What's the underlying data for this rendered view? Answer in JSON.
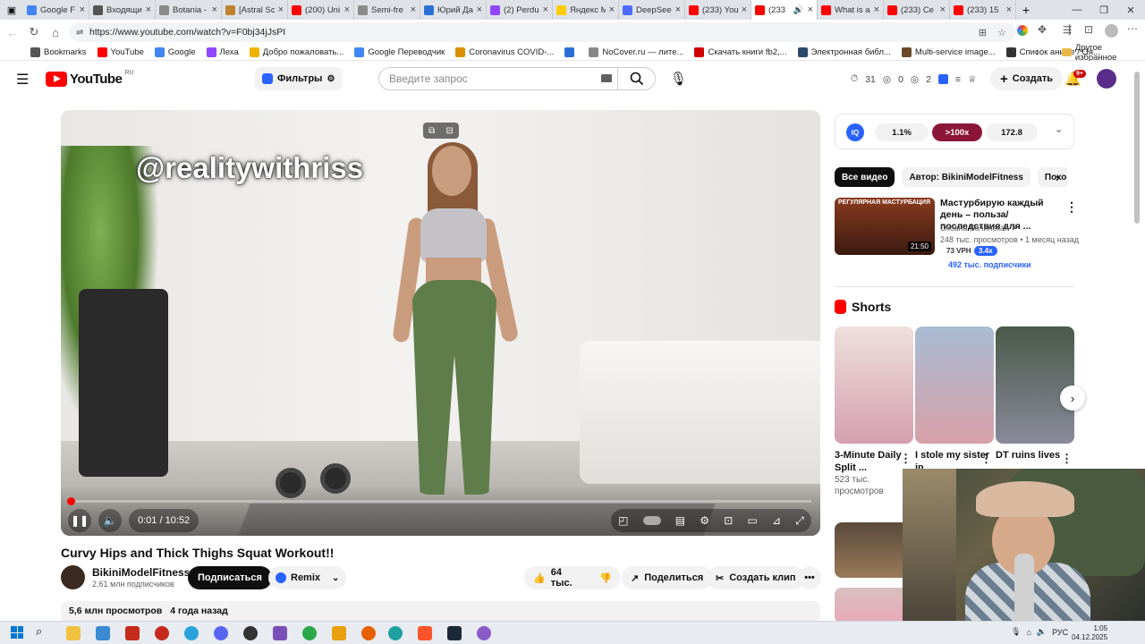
{
  "browser": {
    "tabs": [
      {
        "title": "Google F",
        "color": "#4285f4"
      },
      {
        "title": "Входящи",
        "color": "#555555"
      },
      {
        "title": "Botania -",
        "color": "#8a8a8a"
      },
      {
        "title": "[Astral Sc",
        "color": "#c0842c"
      },
      {
        "title": "(200) Uni",
        "color": "#ff0000"
      },
      {
        "title": "Semi-fre",
        "color": "#8a8a8a"
      },
      {
        "title": "Юрий Да",
        "color": "#2a6fd6"
      },
      {
        "title": "(2) Perdu",
        "color": "#9146ff"
      },
      {
        "title": "Яндекс М",
        "color": "#ffcc00"
      },
      {
        "title": "DeepSee",
        "color": "#4d6bfe"
      },
      {
        "title": "(233) You",
        "color": "#ff0000"
      },
      {
        "title": "(233",
        "color": "#ff0000",
        "active": true,
        "audio": "🔊"
      },
      {
        "title": "What is a",
        "color": "#ff0000"
      },
      {
        "title": "(233) Се",
        "color": "#ff0000"
      },
      {
        "title": "(233) 15",
        "color": "#ff0000"
      }
    ],
    "new_tab": "+",
    "window_controls": {
      "minimize": "—",
      "maximize": "❐",
      "close": "✕"
    },
    "url": "https://www.youtube.com/watch?v=F0bj34jJsPI",
    "bookmarks": [
      {
        "label": "Bookmarks",
        "color": "#555555"
      },
      {
        "label": "YouTube",
        "color": "#ff0000"
      },
      {
        "label": "Google",
        "color": "#4285f4"
      },
      {
        "label": "Леха",
        "color": "#9146ff"
      },
      {
        "label": "Добро пожаловать...",
        "color": "#f0b400"
      },
      {
        "label": "Google Переводчик",
        "color": "#4285f4"
      },
      {
        "label": "Coronavirus COVID-...",
        "color": "#d89000"
      },
      {
        "label": "",
        "color": "#2a6fd6"
      },
      {
        "label": "NoCover.ru — лите...",
        "color": "#888888"
      },
      {
        "label": "Скачать книги fb2,...",
        "color": "#d00000"
      },
      {
        "label": "Электронная библ...",
        "color": "#2a4a6a"
      },
      {
        "label": "Multi-service image...",
        "color": "#6a4a2a"
      },
      {
        "label": "Список аниме / Оя...",
        "color": "#333333"
      }
    ],
    "other_bookmarks": "Другое избранное"
  },
  "youtube": {
    "logo_text": "YouTube",
    "logo_region": "RU",
    "filters_label": "Фильтры",
    "search_placeholder": "Введите запрос",
    "stats": {
      "a": "31",
      "b": "0",
      "c": "2"
    },
    "create_label": "Создать",
    "notif_count": "9+"
  },
  "video": {
    "watermark": "@realitywithriss",
    "current_time": "0:01",
    "duration": "10:52",
    "time_display": "0:01 / 10:52",
    "progress_fraction": 0.0016,
    "title": "Curvy Hips and Thick Thighs Squat Workout!!",
    "channel": "BikiniModelFitness",
    "subscribers": "2,61 млн подписчиков",
    "subscribe_label": "Подписаться",
    "remix_label": "Remix",
    "likes": "64 тыс.",
    "share_label": "Поделиться",
    "clip_label": "Создать клип",
    "more": "•••",
    "views": "5,6 млн просмотров",
    "age": "4 года назад"
  },
  "side": {
    "ext_icon": "IQ",
    "pills": [
      "1.1%",
      ">100x",
      "172.8"
    ],
    "chips": [
      "Все видео",
      "Автор: BikiniModelFitness",
      "Похо"
    ],
    "recommended": {
      "thumb_text": "РЕГУЛЯРНАЯ МАСТУРБАЦИЯ",
      "duration": "21:50",
      "title": "Мастурбирую каждый день – польза/последствия для ...",
      "channel": "Оксана Бачинская",
      "meta": "248 тыс. просмотров • 1 месяц назад",
      "vph": "73 VPH",
      "ratio": "3.4x",
      "subs": "492 тыс. подписчики"
    },
    "shorts_heading": "Shorts",
    "shorts": [
      {
        "title": "3-Minute Daily Split ...",
        "views": "523 тыс. просмотров",
        "color": "#e6c8c4"
      },
      {
        "title": "I stole my sister in...",
        "views": "",
        "color": "#9ab0c8"
      },
      {
        "title": "DT ruins lives",
        "views": "",
        "color": "#6a6a6a"
      }
    ]
  },
  "taskbar": {
    "lang": "РУС",
    "time": "1:05",
    "date": "04.12.2025"
  },
  "colors": {
    "yt_red": "#ff0000",
    "iq_blue": "#2962ff",
    "highlight_pill": "#8b1538"
  }
}
